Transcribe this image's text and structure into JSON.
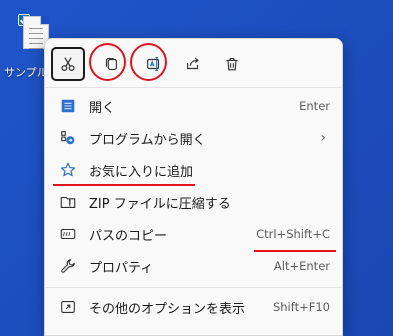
{
  "desktop": {
    "file_label": "サンプル..."
  },
  "toolbar": {
    "buttons": [
      {
        "name": "cut",
        "icon": "scissors-icon"
      },
      {
        "name": "copy",
        "icon": "copy-icon"
      },
      {
        "name": "rename",
        "icon": "rename-icon"
      },
      {
        "name": "share",
        "icon": "share-icon"
      },
      {
        "name": "delete",
        "icon": "trash-icon"
      }
    ]
  },
  "menu": {
    "items": [
      {
        "label": "開く",
        "shortcut": "Enter",
        "icon": "open-app-icon"
      },
      {
        "label": "プログラムから開く",
        "shortcut": "",
        "icon": "open-with-icon",
        "submenu": "›"
      },
      {
        "label": "お気に入りに追加",
        "shortcut": "",
        "icon": "star-icon"
      },
      {
        "label": "ZIP ファイルに圧縮する",
        "shortcut": "",
        "icon": "zip-folder-icon"
      },
      {
        "label": "パスのコピー",
        "shortcut": "Ctrl+Shift+C",
        "icon": "copy-path-icon"
      },
      {
        "label": "プロパティ",
        "shortcut": "Alt+Enter",
        "icon": "wrench-icon"
      },
      {
        "label": "その他のオプションを表示",
        "shortcut": "Shift+F10",
        "icon": "more-options-icon"
      }
    ]
  },
  "colors": {
    "desktop_bg": "#1d4fc0",
    "menu_bg": "#f9f9f9",
    "accent_blue": "#0f6cbd",
    "annotation_red": "#e0141e"
  }
}
